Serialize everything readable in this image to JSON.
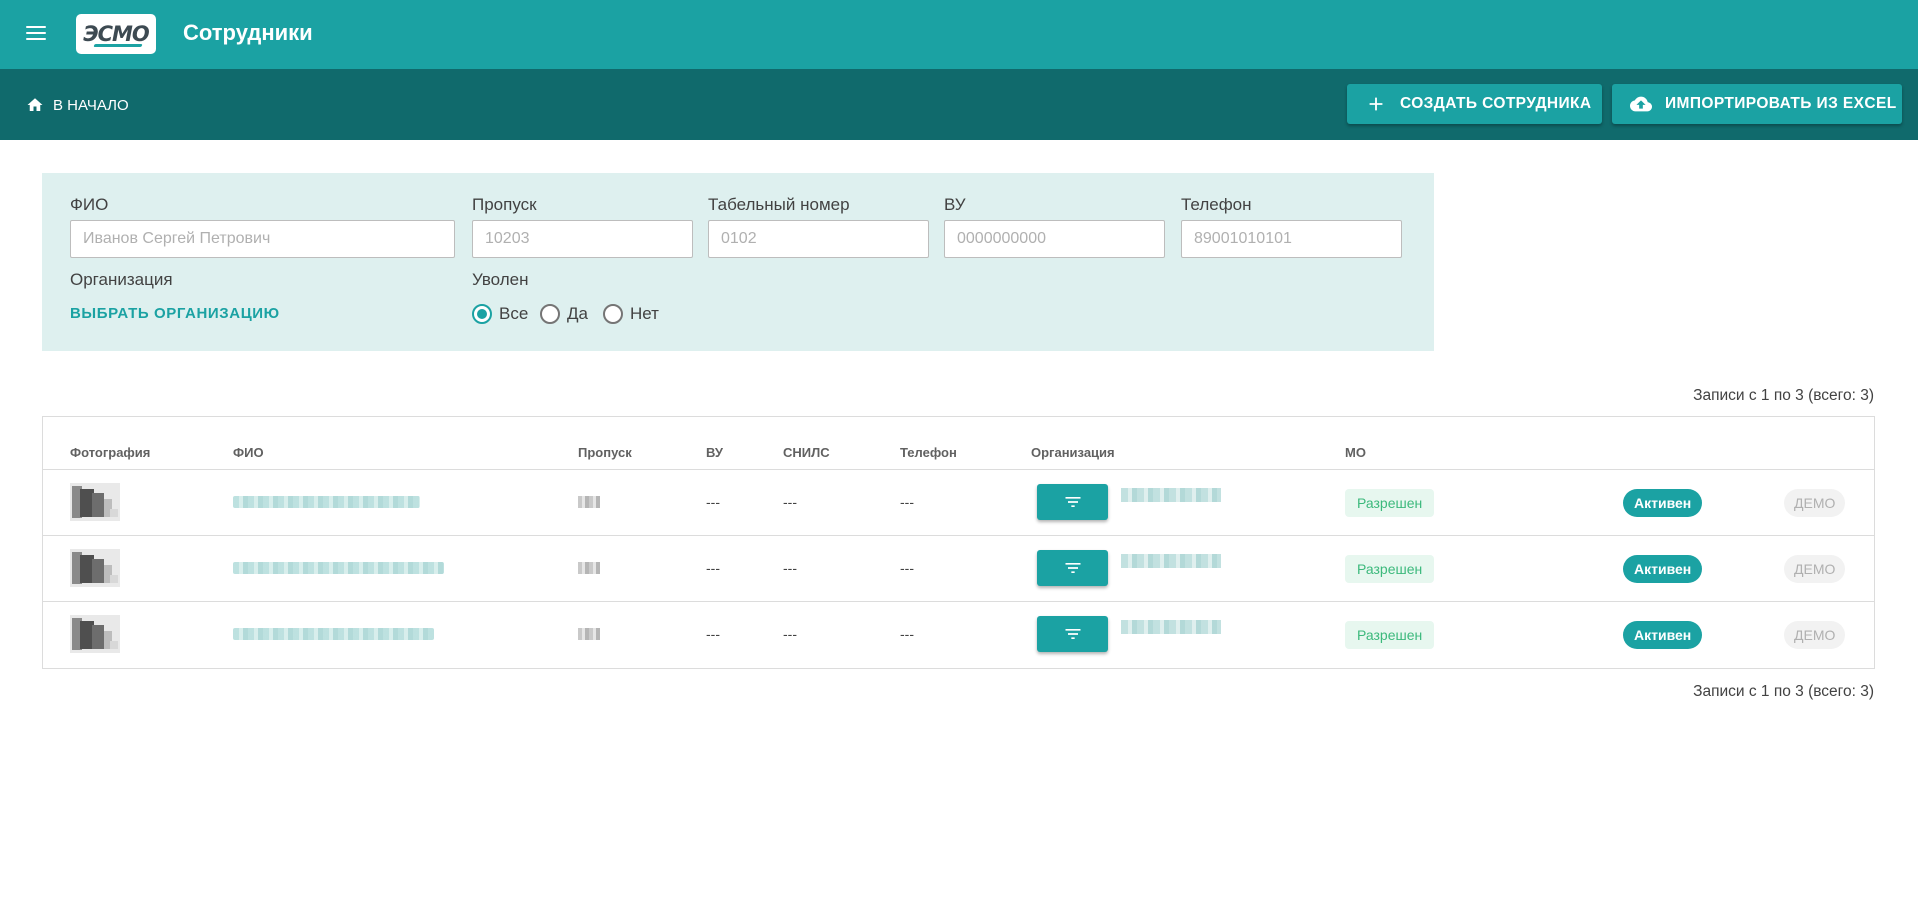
{
  "appbar": {
    "title": "Сотрудники",
    "logo_text": "ЭСМО"
  },
  "subbar": {
    "home_label": "В НАЧАЛО",
    "create_label": "СОЗДАТЬ СОТРУДНИКА",
    "import_label": "ИМПОРТИРОВАТЬ ИЗ EXCEL"
  },
  "filters": {
    "fio": {
      "label": "ФИО",
      "placeholder": "Иванов Сергей Петрович",
      "value": ""
    },
    "pass": {
      "label": "Пропуск",
      "placeholder": "10203",
      "value": ""
    },
    "tab_number": {
      "label": "Табельный номер",
      "placeholder": "0102",
      "value": ""
    },
    "vu": {
      "label": "ВУ",
      "placeholder": "0000000000",
      "value": ""
    },
    "phone": {
      "label": "Телефон",
      "placeholder": "89001010101",
      "value": ""
    },
    "organization": {
      "label": "Организация",
      "link": "ВЫБРАТЬ ОРГАНИЗАЦИЮ"
    },
    "fired": {
      "label": "Уволен",
      "options": [
        "Все",
        "Да",
        "Нет"
      ],
      "selected": "Все"
    }
  },
  "records_info": "Записи с 1 по 3 (всего: 3)",
  "table": {
    "headers": {
      "photo": "Фотография",
      "fio": "ФИО",
      "pass": "Пропуск",
      "vu": "ВУ",
      "snils": "СНИЛС",
      "phone": "Телефон",
      "org": "Организация",
      "mo": "МО"
    },
    "rows": [
      {
        "vu": "---",
        "snils": "---",
        "phone": "---",
        "mo": "Разрешен",
        "status": "Активен",
        "demo": "ДЕМО"
      },
      {
        "vu": "---",
        "snils": "---",
        "phone": "---",
        "mo": "Разрешен",
        "status": "Активен",
        "demo": "ДЕМО"
      },
      {
        "vu": "---",
        "snils": "---",
        "phone": "---",
        "mo": "Разрешен",
        "status": "Активен",
        "demo": "ДЕМО"
      }
    ]
  },
  "colors": {
    "primary": "#1ba2a3",
    "primary_dark": "#106a6c",
    "filter_bg": "#def0ef",
    "allowed_text": "#3cb97c"
  },
  "icons": [
    "menu-icon",
    "home-icon",
    "plus-icon",
    "cloud-upload-icon",
    "filter-icon",
    "photo-thumbnail"
  ]
}
